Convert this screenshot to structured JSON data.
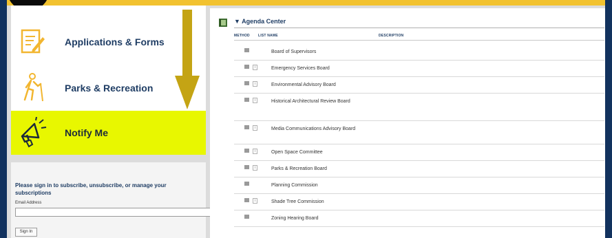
{
  "nav": {
    "items": [
      {
        "label": "Applications & Forms",
        "icon": "document-edit-icon"
      },
      {
        "label": "Parks & Recreation",
        "icon": "hiker-icon"
      },
      {
        "label": "Notify Me",
        "icon": "megaphone-icon",
        "highlighted": true
      }
    ]
  },
  "signin": {
    "message": "Please sign in to subscribe, unsubscribe, or manage your subscriptions",
    "email_label": "Email Address",
    "email_value": "",
    "button_label": "Sign In"
  },
  "agenda": {
    "title": "▼ Agenda Center",
    "columns": {
      "method": "METHOD",
      "list_name": "LIST NAME",
      "description": "DESCRIPTION"
    },
    "rows": [
      {
        "name": "Board of Supervisors",
        "methods": [
          "email"
        ]
      },
      {
        "name": "Emergency Services Board",
        "methods": [
          "email",
          "sms"
        ]
      },
      {
        "name": "Environmental Advisory Board",
        "methods": [
          "email",
          "sms"
        ]
      },
      {
        "name": "Historical Architectural Review Board",
        "methods": [
          "email",
          "sms"
        ]
      },
      {
        "name": "Media Communications Advisory Board",
        "methods": [
          "email",
          "sms"
        ]
      },
      {
        "name": "Open Space Committee",
        "methods": [
          "email",
          "sms"
        ]
      },
      {
        "name": "Parks & Recreation Board",
        "methods": [
          "email",
          "sms"
        ]
      },
      {
        "name": "Planning Commission",
        "methods": [
          "email"
        ]
      },
      {
        "name": "Shade Tree Commission",
        "methods": [
          "email",
          "sms"
        ]
      },
      {
        "name": "Zoning Hearing Board",
        "methods": [
          "email"
        ]
      }
    ]
  },
  "colors": {
    "accent_yellow": "#f2c230",
    "highlight": "#e8f700",
    "navy": "#1f3d64",
    "arrow": "#c4a414"
  }
}
